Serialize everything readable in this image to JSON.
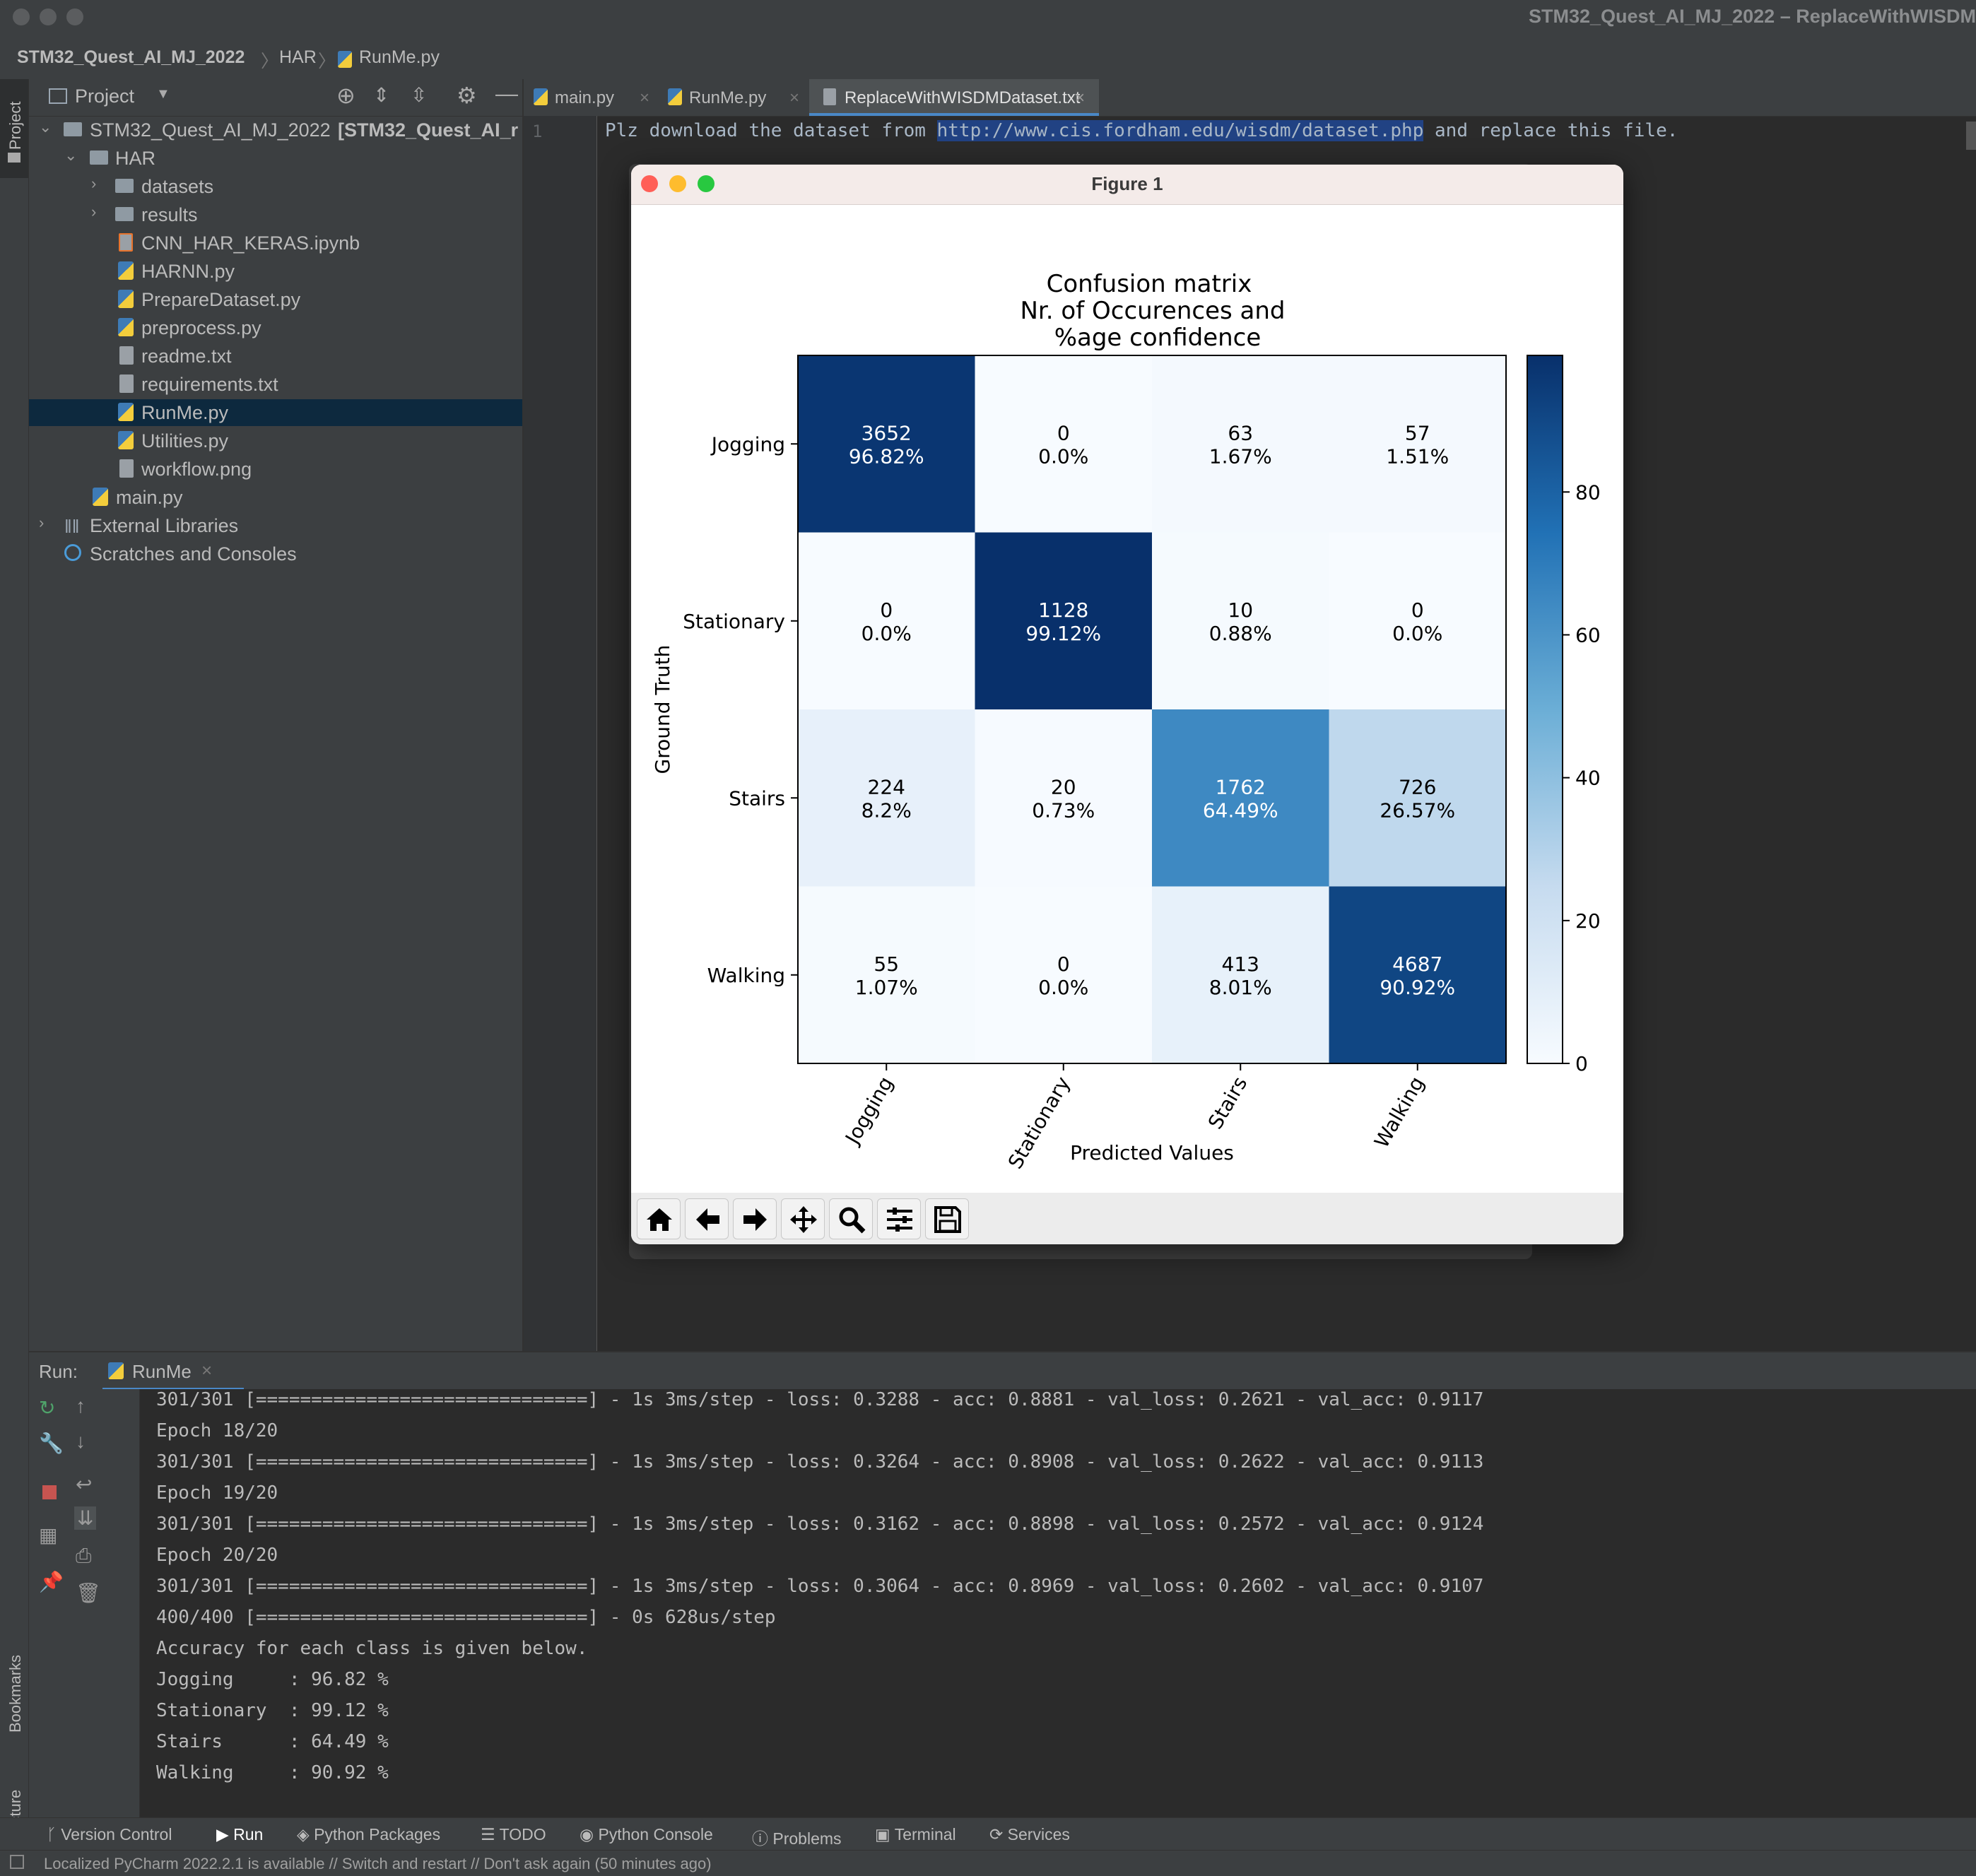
{
  "window": {
    "title": "STM32_Quest_AI_MJ_2022 – ReplaceWithWISDM"
  },
  "breadcrumb": {
    "project": "STM32_Quest_AI_MJ_2022",
    "folder": "HAR",
    "file": "RunMe.py"
  },
  "left_strip": {
    "project_label": "Project",
    "bookmarks_label": "Bookmarks",
    "structure_label": "Structure"
  },
  "project_panel": {
    "title": "Project",
    "tree": {
      "root": "STM32_Quest_AI_MJ_2022",
      "root_bold": "[STM32_Quest_AI_r",
      "har": "HAR",
      "datasets": "datasets",
      "results": "results",
      "f1": "CNN_HAR_KERAS.ipynb",
      "f2": "HARNN.py",
      "f3": "PrepareDataset.py",
      "f4": "preprocess.py",
      "f5": "readme.txt",
      "f6": "requirements.txt",
      "f7": "RunMe.py",
      "f8": "Utilities.py",
      "f9": "workflow.png",
      "main": "main.py",
      "ext": "External Libraries",
      "scratch": "Scratches and Consoles"
    }
  },
  "editor": {
    "tabs": [
      "main.py",
      "RunMe.py",
      "ReplaceWithWISDMDataset.txt"
    ],
    "line_number": "1",
    "code_before": "Plz download the dataset from ",
    "code_url": "http://www.cis.fordham.edu/wisdm/dataset.php",
    "code_after": " and replace this file."
  },
  "figure": {
    "title": "Figure 1",
    "toolbar": [
      "home-icon",
      "back-arrow-icon",
      "forward-arrow-icon",
      "pan-icon",
      "zoom-icon",
      "configure-icon",
      "save-icon"
    ]
  },
  "chart_data": {
    "type": "heatmap",
    "title": [
      "Confusion matrix",
      "Nr. of Occurences and",
      "%age confidence"
    ],
    "xlabel": "Predicted Values",
    "ylabel": "Ground Truth",
    "categories": [
      "Jogging",
      "Stationary",
      "Stairs",
      "Walking"
    ],
    "counts": [
      [
        3652,
        0,
        63,
        57
      ],
      [
        0,
        1128,
        10,
        0
      ],
      [
        224,
        20,
        1762,
        726
      ],
      [
        55,
        0,
        413,
        4687
      ]
    ],
    "percent_labels": [
      [
        "96.82%",
        "0.0%",
        "1.67%",
        "1.51%"
      ],
      [
        "0.0%",
        "99.12%",
        "0.88%",
        "0.0%"
      ],
      [
        "8.2%",
        "0.73%",
        "64.49%",
        "26.57%"
      ],
      [
        "1.07%",
        "0.0%",
        "8.01%",
        "90.92%"
      ]
    ],
    "percent": [
      [
        96.82,
        0.0,
        1.67,
        1.51
      ],
      [
        0.0,
        99.12,
        0.88,
        0.0
      ],
      [
        8.2,
        0.73,
        64.49,
        26.57
      ],
      [
        1.07,
        0.0,
        8.01,
        90.92
      ]
    ],
    "colorbar": {
      "ticks": [
        0,
        20,
        40,
        60,
        80
      ],
      "range": [
        0,
        99.12
      ],
      "colormap": "Blues"
    }
  },
  "run": {
    "label": "Run:",
    "tab": "RunMe",
    "console": [
      "301/301 [==============================] - 1s 3ms/step - loss: 0.3288 - acc: 0.8881 - val_loss: 0.2621 - val_acc: 0.9117",
      "Epoch 18/20",
      "301/301 [==============================] - 1s 3ms/step - loss: 0.3264 - acc: 0.8908 - val_loss: 0.2622 - val_acc: 0.9113",
      "Epoch 19/20",
      "301/301 [==============================] - 1s 3ms/step - loss: 0.3162 - acc: 0.8898 - val_loss: 0.2572 - val_acc: 0.9124",
      "Epoch 20/20",
      "301/301 [==============================] - 1s 3ms/step - loss: 0.3064 - acc: 0.8969 - val_loss: 0.2602 - val_acc: 0.9107",
      "400/400 [==============================] - 0s 628us/step",
      "Accuracy for each class is given below.",
      "Jogging     : 96.82 %",
      "Stationary  : 99.12 %",
      "Stairs      : 64.49 %",
      "Walking     : 90.92 %"
    ]
  },
  "bottom_tabs": [
    "Version Control",
    "Run",
    "Python Packages",
    "TODO",
    "Python Console",
    "Problems",
    "Terminal",
    "Services"
  ],
  "status": "Localized PyCharm 2022.2.1 is available // Switch and restart // Don't ask again (50 minutes ago)",
  "colors": {
    "accent": "#4a88c7",
    "selection": "#0d293e",
    "url_highlight": "#214283",
    "heat_dark": "#08306b"
  }
}
